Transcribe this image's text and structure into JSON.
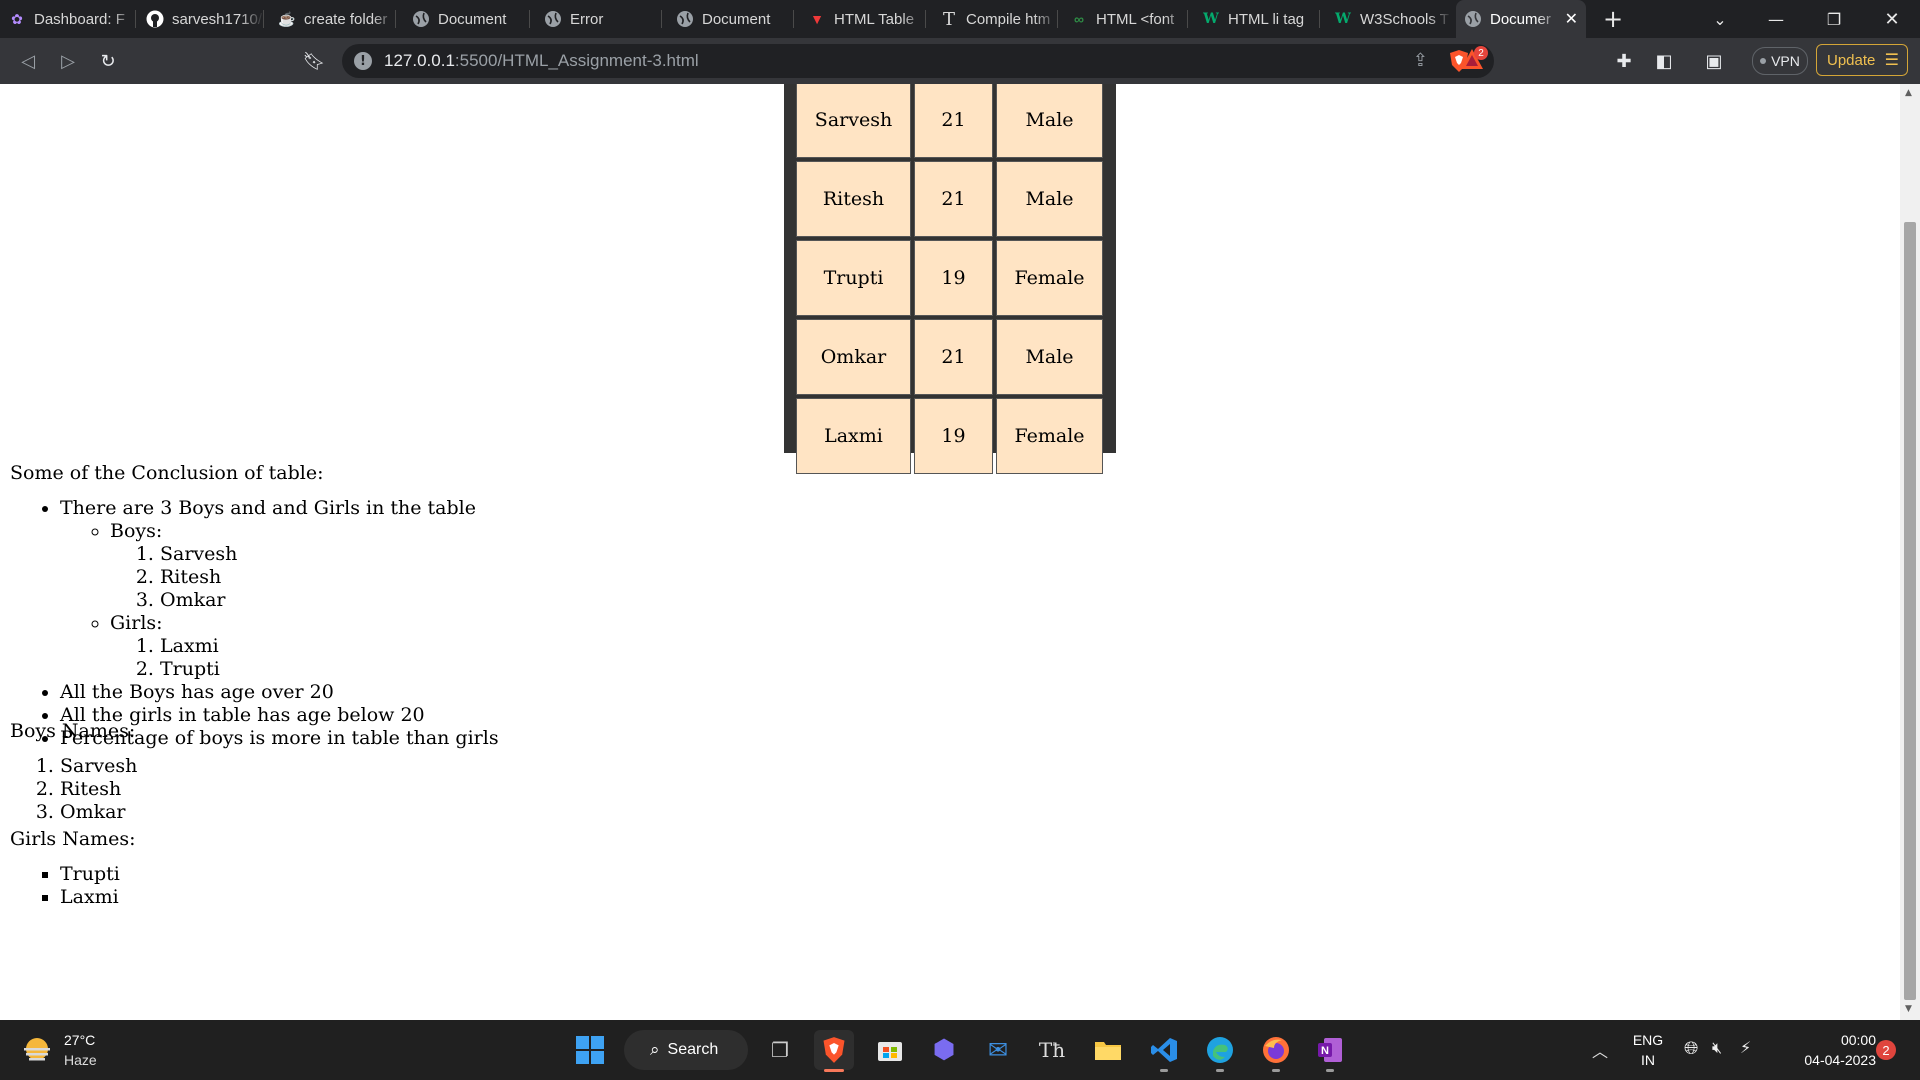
{
  "browser": {
    "tabs": [
      {
        "title": "Dashboard: F",
        "icon": "app-icon"
      },
      {
        "title": "sarvesh1710/",
        "icon": "github-icon"
      },
      {
        "title": "create folder",
        "icon": "java-icon"
      },
      {
        "title": "Document",
        "icon": "globe-icon"
      },
      {
        "title": "Error",
        "icon": "globe-icon"
      },
      {
        "title": "Document",
        "icon": "globe-icon"
      },
      {
        "title": "HTML Table",
        "icon": "vivaldi-icon"
      },
      {
        "title": "Compile htm",
        "icon": "text-icon"
      },
      {
        "title": "HTML <font",
        "icon": "geeks-icon"
      },
      {
        "title": "HTML li tag",
        "icon": "w3schools-icon"
      },
      {
        "title": "W3Schools T",
        "icon": "w3schools-icon"
      },
      {
        "title": "Documer",
        "icon": "globe-icon",
        "active": true
      }
    ],
    "url_host": "127.0.0.1",
    "url_path": ":5500/HTML_Assignment-3.html",
    "vpn_label": "VPN",
    "update_label": "Update",
    "brave_badge": "2"
  },
  "table": {
    "rows": [
      {
        "name": "Sarvesh",
        "age": "21",
        "gender": "Male"
      },
      {
        "name": "Ritesh",
        "age": "21",
        "gender": "Male"
      },
      {
        "name": "Trupti",
        "age": "19",
        "gender": "Female"
      },
      {
        "name": "Omkar",
        "age": "21",
        "gender": "Male"
      },
      {
        "name": "Laxmi",
        "age": "19",
        "gender": "Female"
      }
    ]
  },
  "conclusion": {
    "heading": "Some of the Conclusion of table:",
    "point1": "There are 3 Boys and and Girls in the table",
    "boys_label": "Boys:",
    "boys": [
      "Sarvesh",
      "Ritesh",
      "Omkar"
    ],
    "girls_label": "Girls:",
    "girls": [
      "Laxmi",
      "Trupti"
    ],
    "point2": "All the Boys has age over 20",
    "point3": "All the girls in table has age below 20",
    "point4": "Percentage of boys is more in table than girls"
  },
  "boys_names": {
    "heading": "Boys Names:",
    "items": [
      "Sarvesh",
      "Ritesh",
      "Omkar"
    ]
  },
  "girls_names": {
    "heading": "Girls Names:",
    "items": [
      "Trupti",
      "Laxmi"
    ]
  },
  "taskbar": {
    "weather_temp": "27°C",
    "weather_desc": "Haze",
    "search_label": "Search",
    "lang_top": "ENG",
    "lang_bottom": "IN",
    "time": "00:00",
    "date": "04-04-2023",
    "notif_count": "2"
  }
}
